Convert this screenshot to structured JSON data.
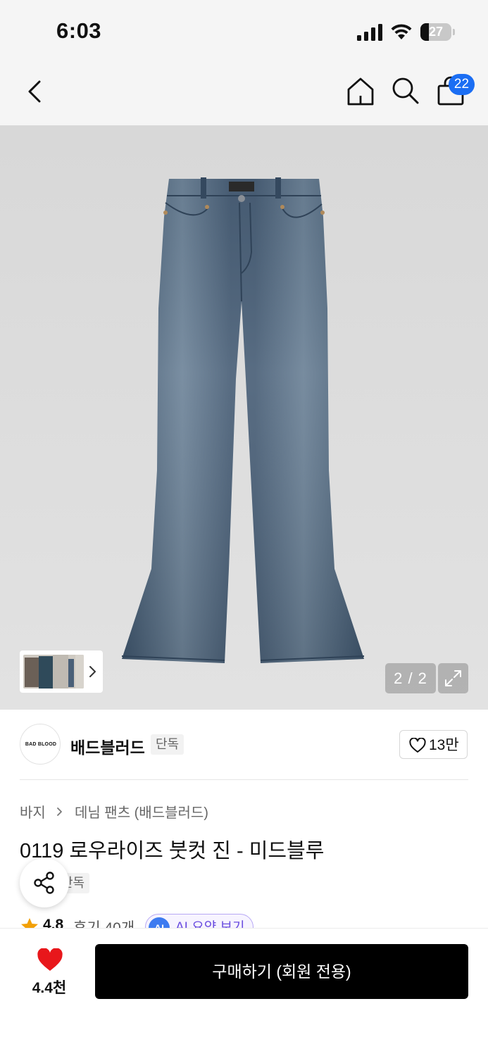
{
  "status_bar": {
    "time": "6:03",
    "battery_level": "27",
    "battery_fraction": 0.27
  },
  "nav": {
    "back_icon": "chevron-left-icon",
    "home_icon": "home-icon",
    "search_icon": "search-icon",
    "cart_icon": "shopping-bag-icon",
    "cart_count": "22",
    "accent_color": "#1b6ef3"
  },
  "gallery": {
    "counter": "2 / 2",
    "expand_icon": "expand-icon"
  },
  "brand": {
    "logo_text": "BAD BLOOD",
    "name": "배드블러드",
    "tag": "단독",
    "like_count": "13만"
  },
  "product": {
    "breadcrumb": [
      "바지",
      "데님 팬츠 (배드블러드)"
    ],
    "title": "0119 로우라이즈 붓컷 진 - 미드블루",
    "tag": "단독",
    "rating": "4.8",
    "review_count": "후기 40개",
    "ai_badge": "AI",
    "ai_summary": "AI 요약 보기"
  },
  "bottom_bar": {
    "wish_count": "4.4천",
    "buy_label": "구매하기 (회원 전용)",
    "heart_color": "#e8171b"
  }
}
